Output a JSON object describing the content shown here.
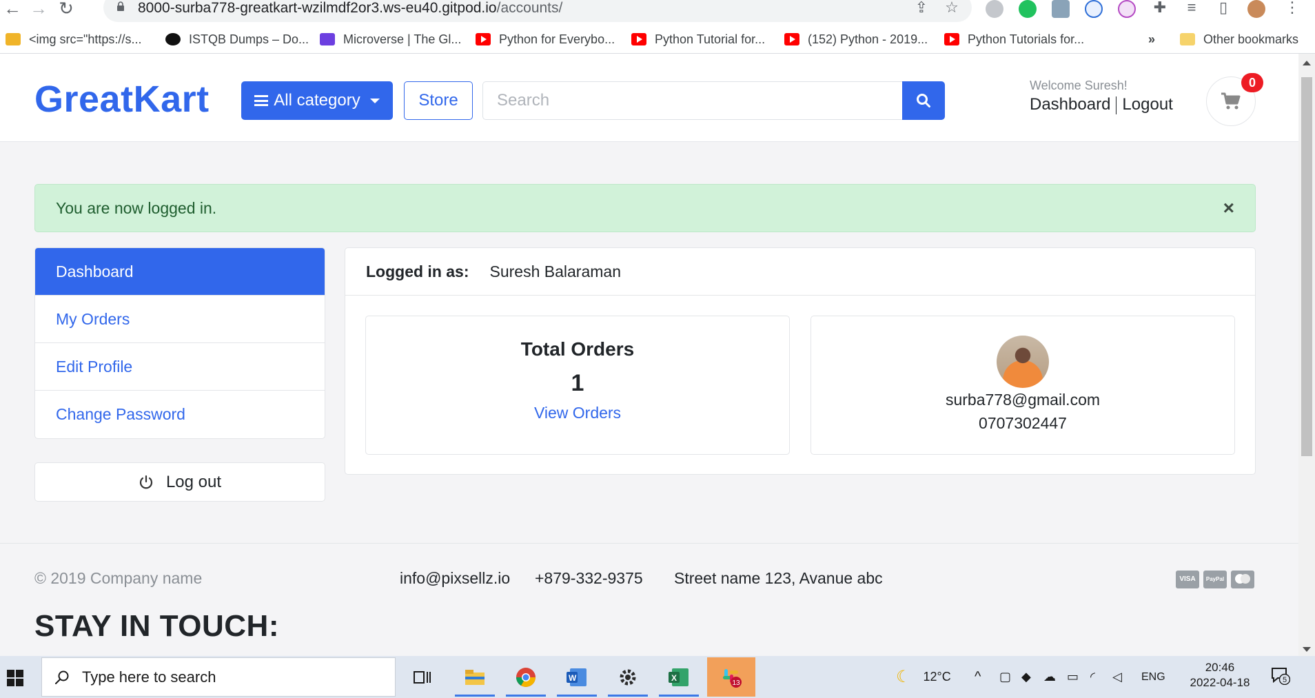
{
  "browser": {
    "url_host": "8000-surba778-greatkart-wzilmdf2or3.ws-eu40.gitpod.io",
    "url_path": "/accounts/",
    "bookmarks": [
      {
        "label": "<img src=\"https://s...",
        "icon": "bookmark-favicon"
      },
      {
        "label": "ISTQB Dumps – Do...",
        "icon": "g-icon"
      },
      {
        "label": "Microverse | The Gl...",
        "icon": "microverse-icon"
      },
      {
        "label": "Python for Everybo...",
        "icon": "youtube-icon"
      },
      {
        "label": "Python Tutorial for...",
        "icon": "youtube-icon"
      },
      {
        "label": "(152) Python - 2019...",
        "icon": "youtube-icon"
      },
      {
        "label": "Python Tutorials for...",
        "icon": "youtube-icon"
      }
    ],
    "more_bookmarks": "»",
    "other_bookmarks": "Other bookmarks"
  },
  "header": {
    "logo_first": "Great",
    "logo_second": "Kart",
    "category_button": "All category",
    "store_button": "Store",
    "search_placeholder": "Search",
    "welcome": "Welcome Suresh!",
    "dashboard_link": "Dashboard",
    "logout_link": "Logout",
    "cart_count": "0"
  },
  "alert": {
    "message": "You are now logged in.",
    "close": "×"
  },
  "sidebar": {
    "items": [
      {
        "label": "Dashboard"
      },
      {
        "label": "My Orders"
      },
      {
        "label": "Edit Profile"
      },
      {
        "label": "Change Password"
      }
    ],
    "logout_label": "Log out"
  },
  "main": {
    "logged_in_label": "Logged in as:",
    "user_name": "Suresh Balaraman",
    "orders_title": "Total Orders",
    "orders_count": "1",
    "view_orders": "View Orders",
    "email": "surba778@gmail.com",
    "phone": "0707302447"
  },
  "footer": {
    "copyright": "© 2019 Company name",
    "email": "info@pixsellz.io",
    "phone": "+879-332-9375",
    "address": "Street name 123, Avanue abc",
    "payments": [
      "VISA",
      "PayPal",
      "MasterCard"
    ],
    "stay_in_touch": "STAY IN TOUCH:"
  },
  "taskbar": {
    "search_placeholder": "Type here to search",
    "temperature": "12°C",
    "language": "ENG",
    "time": "20:46",
    "date": "2022-04-18",
    "slack_badge": "13",
    "notif_count": "5"
  },
  "colors": {
    "brand_blue": "#3167eb",
    "alert_green": "#d1f2d9",
    "badge_red": "#ed1c24"
  }
}
